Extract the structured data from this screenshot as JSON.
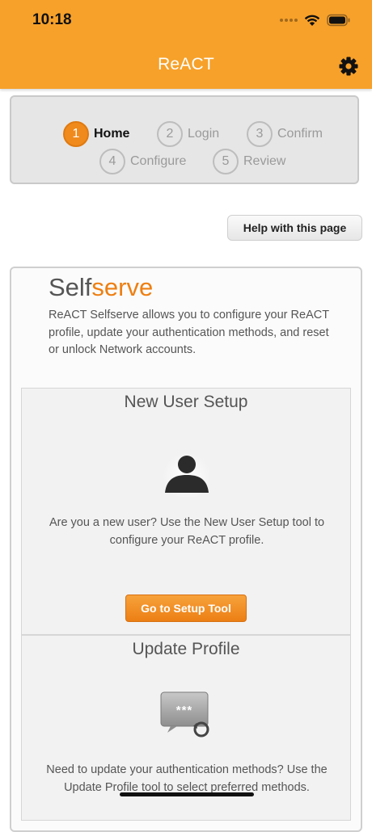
{
  "status_bar": {
    "time": "10:18"
  },
  "header": {
    "title": "ReACT"
  },
  "steps": [
    {
      "num": "1",
      "label": "Home"
    },
    {
      "num": "2",
      "label": "Login"
    },
    {
      "num": "3",
      "label": "Confirm"
    },
    {
      "num": "4",
      "label": "Configure"
    },
    {
      "num": "5",
      "label": "Review"
    }
  ],
  "help_button": {
    "label": "Help with this page"
  },
  "selfserve": {
    "brand_main": "Self",
    "brand_accent": "serve",
    "intro": "ReACT Selfserve allows you to configure your ReACT profile, update your authentication methods, and reset or unlock Network accounts."
  },
  "new_user_setup": {
    "title": "New User Setup",
    "text": "Are you a new user? Use the New User Setup tool to configure your ReACT profile.",
    "button": "Go to Setup Tool"
  },
  "update_profile": {
    "title": "Update Profile",
    "icon_text": "***",
    "text": "Need to update your authentication methods? Use the Update Profile tool to select preferred methods."
  },
  "colors": {
    "header": "#f7a12a",
    "accent": "#ee7f12",
    "step_active": "#f08a1c"
  }
}
